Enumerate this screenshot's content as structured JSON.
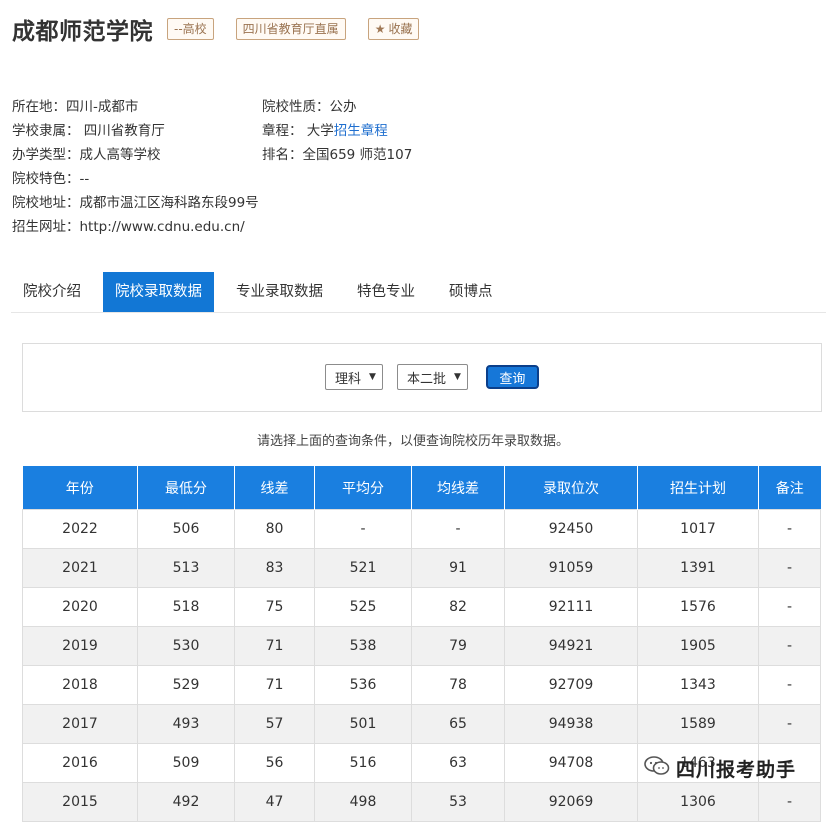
{
  "header": {
    "title": "成都师范学院",
    "tag_level": "--高校",
    "tag_affiliation": "四川省教育厅直属",
    "favorite_label": "收藏"
  },
  "info": {
    "location": "所在地：四川-成都市",
    "affiliation": "学校隶属： 四川省教育厅",
    "school_type": "办学类型：成人高等学校",
    "features": "院校特色：--",
    "address": "院校地址：成都市温江区海科路东段99号",
    "website": "招生网址：http://www.cdnu.edu.cn/",
    "nature": "院校性质：公办",
    "charter_prefix": "章程： 大学",
    "charter_link": "招生章程",
    "ranking": "排名：全国659 师范107"
  },
  "tabs": [
    {
      "label": "院校介绍",
      "active": false
    },
    {
      "label": "院校录取数据",
      "active": true
    },
    {
      "label": "专业录取数据",
      "active": false
    },
    {
      "label": "特色专业",
      "active": false
    },
    {
      "label": "硕博点",
      "active": false
    }
  ],
  "query": {
    "subject_selected": "理科",
    "batch_selected": "本二批",
    "button_label": "查询"
  },
  "hint": "请选择上面的查询条件，以便查询院校历年录取数据。",
  "table": {
    "headers": [
      "年份",
      "最低分",
      "线差",
      "平均分",
      "均线差",
      "录取位次",
      "招生计划",
      "备注"
    ],
    "rows": [
      [
        "2022",
        "506",
        "80",
        "-",
        "-",
        "92450",
        "1017",
        "-"
      ],
      [
        "2021",
        "513",
        "83",
        "521",
        "91",
        "91059",
        "1391",
        "-"
      ],
      [
        "2020",
        "518",
        "75",
        "525",
        "82",
        "92111",
        "1576",
        "-"
      ],
      [
        "2019",
        "530",
        "71",
        "538",
        "79",
        "94921",
        "1905",
        "-"
      ],
      [
        "2018",
        "529",
        "71",
        "536",
        "78",
        "92709",
        "1343",
        "-"
      ],
      [
        "2017",
        "493",
        "57",
        "501",
        "65",
        "94938",
        "1589",
        "-"
      ],
      [
        "2016",
        "509",
        "56",
        "516",
        "63",
        "94708",
        "1463",
        "-"
      ],
      [
        "2015",
        "492",
        "47",
        "498",
        "53",
        "92069",
        "1306",
        "-"
      ]
    ]
  },
  "watermark": "四川报考助手"
}
